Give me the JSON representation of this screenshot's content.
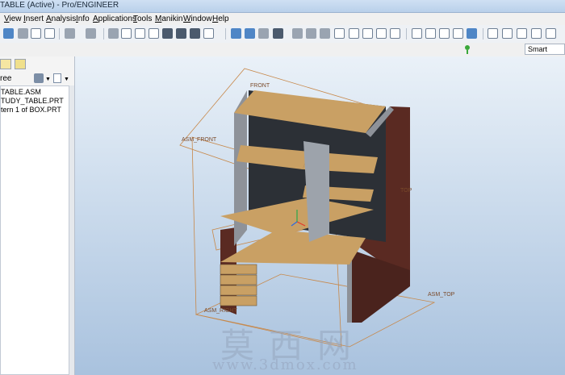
{
  "window": {
    "title": "TABLE (Active) - Pro/ENGINEER"
  },
  "menu": [
    "View",
    "Insert",
    "Analysis",
    "Info",
    "Applications",
    "Tools",
    "Manikin",
    "Window",
    "Help"
  ],
  "search": {
    "filter_value": "Smart"
  },
  "model_tree": {
    "header": "ree",
    "items": [
      "TABLE.ASM",
      "TUDY_TABLE.PRT",
      "tern 1 of BOX.PRT"
    ]
  },
  "viewport": {
    "datum_labels": {
      "front": "FRONT",
      "asm_front": "ASM_FRONT",
      "top": "TOP",
      "asm_top": "ASM_TOP",
      "asm_right": "ASM_RIGHT"
    },
    "watermark": {
      "chars": "莫西网",
      "url": "www.3dmox.com"
    }
  },
  "colors": {
    "viewport_top": "#eaf1f8",
    "viewport_bottom": "#a9c2de",
    "wood": "#c9a064",
    "dark_panel": "#5a2a22",
    "frame": "#8e9299",
    "datum": "#c7884a"
  }
}
